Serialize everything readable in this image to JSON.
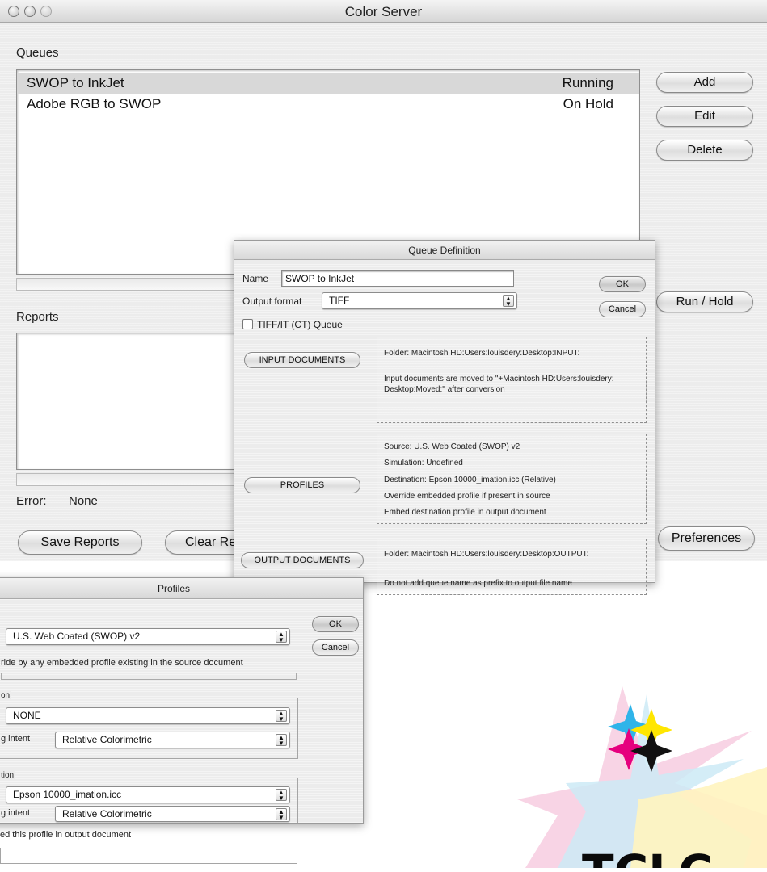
{
  "window": {
    "title": "Color Server",
    "queues_label": "Queues",
    "queues": [
      {
        "name": "SWOP to InkJet",
        "status": "Running",
        "selected": true
      },
      {
        "name": "Adobe RGB to SWOP",
        "status": "On Hold",
        "selected": false
      }
    ],
    "buttons": {
      "add": "Add",
      "edit": "Edit",
      "delete": "Delete",
      "run_hold": "Run / Hold",
      "preferences": "Preferences"
    },
    "reports_label": "Reports",
    "error_label": "Error:",
    "error_value": "None",
    "save_reports": "Save Reports",
    "clear_reports": "Clear Rep"
  },
  "queue_def": {
    "title": "Queue Definition",
    "name_label": "Name",
    "name_value": "SWOP to InkJet",
    "output_format_label": "Output format",
    "output_format_value": "TIFF",
    "ok": "OK",
    "cancel": "Cancel",
    "tiffit_label": "TIFF/IT (CT) Queue",
    "input_button": "INPUT DOCUMENTS",
    "input_folder": "Folder:    Macintosh HD:Users:louisdery:Desktop:INPUT:",
    "input_note_1": "Input documents are moved to \"+Macintosh HD:Users:louisdery:",
    "input_note_2": "Desktop:Moved:\" after conversion",
    "profiles_button": "PROFILES",
    "prof_source": "Source:       U.S. Web Coated (SWOP) v2",
    "prof_simulation": "Simulation:   Undefined",
    "prof_destination": "Destination:  Epson 10000_imation.icc (Relative)",
    "prof_override": "Override embedded profile if present in source",
    "prof_embed": "Embed destination profile in output document",
    "output_button": "OUTPUT DOCUMENTS",
    "output_folder": "Folder:    Macintosh HD:Users:louisdery:Desktop:OUTPUT:",
    "output_note": "Do not add queue name as prefix to output file name"
  },
  "profiles": {
    "title": "Profiles",
    "source_value": "U.S. Web Coated (SWOP) v2",
    "ok": "OK",
    "cancel": "Cancel",
    "override_text": "ride by any embedded profile existing in the source document",
    "simulation_group": "on",
    "simulation_value": "NONE",
    "sim_intent_label": "g intent",
    "sim_intent_value": "Relative Colorimetric",
    "destination_group": "tion",
    "destination_value": "Epson 10000_imation.icc",
    "dest_intent_label": "g intent",
    "dest_intent_value": "Relative Colorimetric",
    "embed_text": "ed this profile in output document"
  },
  "logo": {
    "text": "TCLC",
    "colors": {
      "cyan": "#2fb4e9",
      "magenta": "#e6007e",
      "yellow": "#ffe600",
      "black": "#111111"
    }
  }
}
